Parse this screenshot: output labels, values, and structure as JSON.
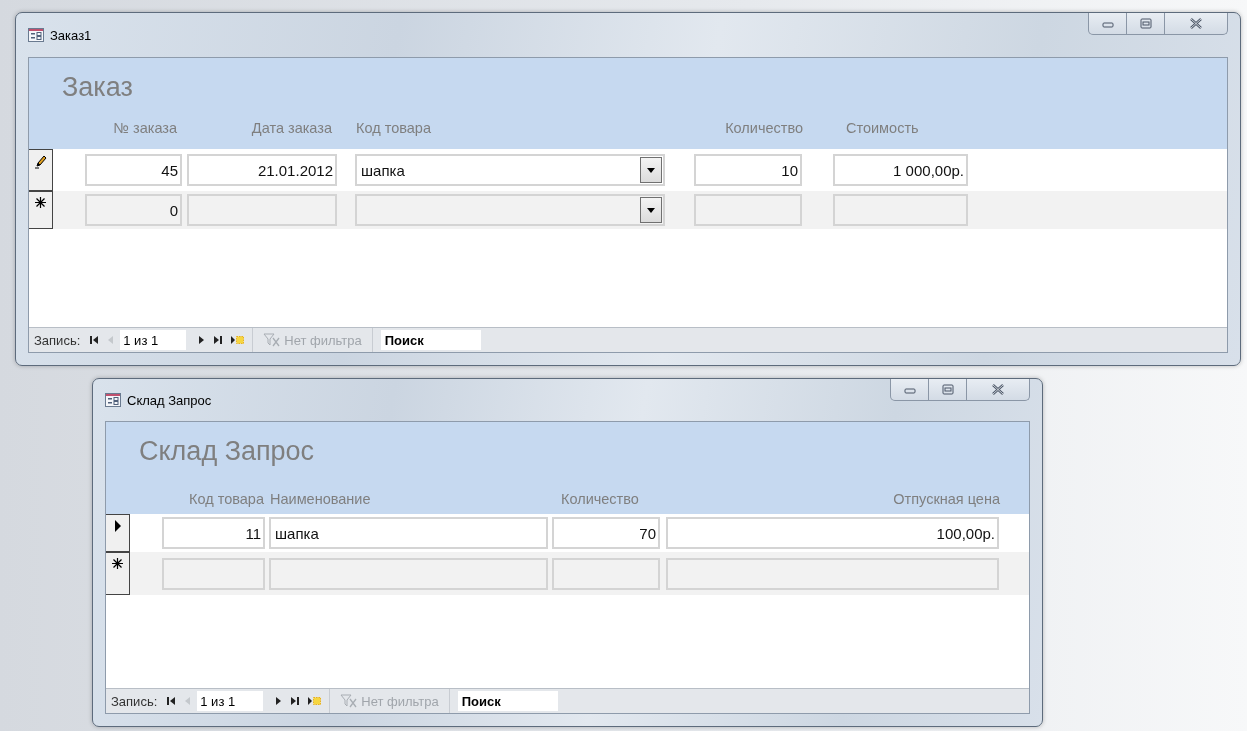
{
  "windows": [
    {
      "title": "Заказ1",
      "form_title": "Заказ",
      "columns": [
        "№ заказа",
        "Дата заказа",
        "Код товара",
        "Количество",
        "Стоимость"
      ],
      "rows": [
        {
          "kind": "editing",
          "cells": [
            {
              "kind": "number",
              "value": "45"
            },
            {
              "kind": "number",
              "value": "21.01.2012"
            },
            {
              "kind": "combo",
              "value": "шапка"
            },
            {
              "kind": "number",
              "value": "10"
            },
            {
              "kind": "number",
              "value": "1 000,00р."
            }
          ]
        },
        {
          "kind": "new",
          "cells": [
            {
              "kind": "number",
              "value": "0"
            },
            {
              "kind": "number"
            },
            {
              "kind": "combo"
            },
            {
              "kind": "number"
            },
            {
              "kind": "number"
            }
          ]
        }
      ],
      "nav": {
        "label": "Запись:",
        "position": "1 из 1",
        "prev_disabled": true,
        "filter": "Нет фильтра",
        "filter_disabled": true,
        "search_placeholder": "Поиск"
      }
    },
    {
      "title": "Склад Запрос",
      "form_title": "Склад Запрос",
      "columns": [
        "Код товара",
        "Наименование",
        "Количество",
        "Отпускная цена"
      ],
      "rows": [
        {
          "kind": "current",
          "cells": [
            {
              "kind": "number",
              "value": "11"
            },
            {
              "kind": "text",
              "value": "шапка"
            },
            {
              "kind": "number",
              "value": "70"
            },
            {
              "kind": "number",
              "value": "100,00р."
            }
          ]
        },
        {
          "kind": "new",
          "cells": [
            {
              "kind": "number"
            },
            {
              "kind": "text"
            },
            {
              "kind": "number"
            },
            {
              "kind": "number"
            }
          ]
        }
      ],
      "nav": {
        "label": "Запись:",
        "position": "1 из 1",
        "prev_disabled": true,
        "filter": "Нет фильтра",
        "filter_disabled": true,
        "search_placeholder": "Поиск"
      }
    }
  ]
}
